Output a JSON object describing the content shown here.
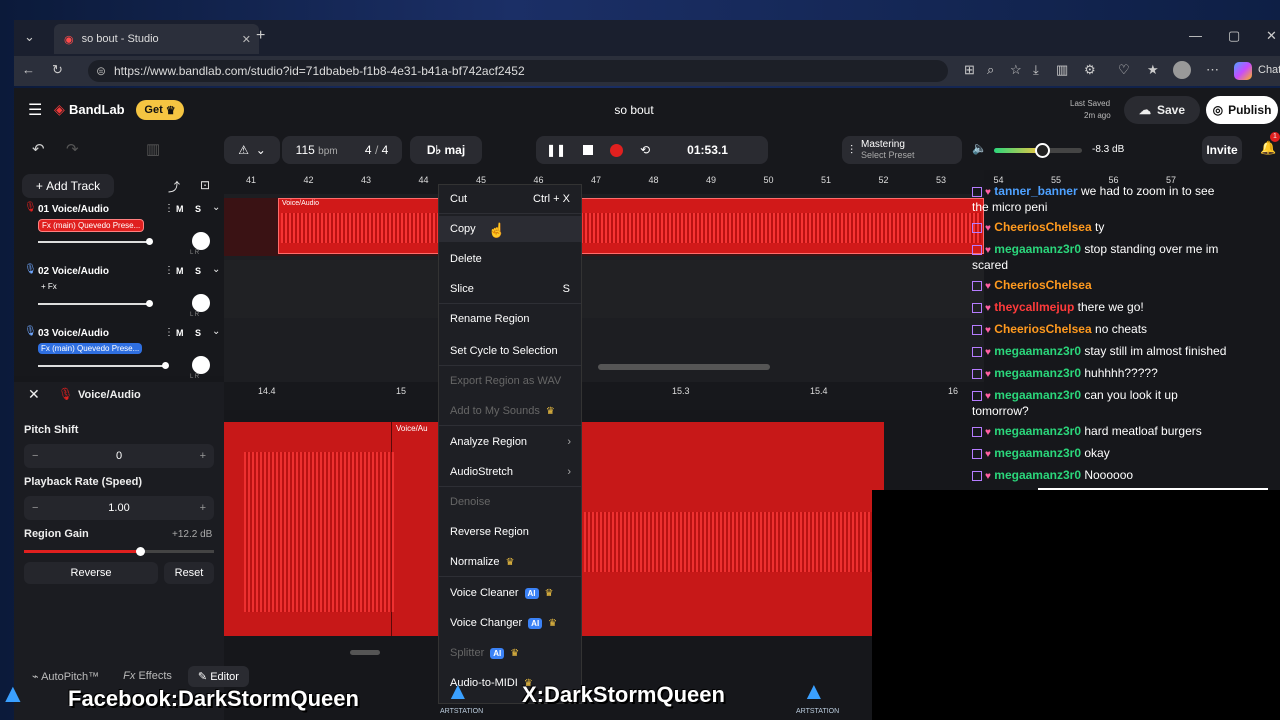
{
  "browser": {
    "tab_title": "so bout - Studio",
    "url": "https://www.bandlab.com/studio?id=71dbabeb-f1b8-4e31-b41a-bf742acf2452",
    "chat_label": "Chat"
  },
  "app": {
    "logo": "BandLab",
    "get_label": "Get",
    "project_title": "so bout",
    "last_saved_label": "Last Saved",
    "last_saved_time": "2m ago",
    "save_label": "Save",
    "publish_label": "Publish",
    "bpm": "115",
    "bpm_unit": "bpm",
    "time_sig_num": "4",
    "time_sig_den": "4",
    "key": "D♭ maj",
    "time": "01:53.1",
    "mastering_label": "Mastering",
    "mastering_sub": "Select Preset",
    "volume_db": "-8.3 dB",
    "invite_label": "Invite",
    "notif_count": "1",
    "volume_level": 0.55
  },
  "tracks": {
    "add_track_label": "Add Track",
    "list": [
      {
        "name": "01  Voice/Audio",
        "fx": "Fx (main) Quevedo Prese...",
        "fx_style": "red",
        "m": "M",
        "s": "S",
        "lr": "L   R"
      },
      {
        "name": "02  Voice/Audio",
        "fx": "+ Fx",
        "fx_style": "plain",
        "m": "M",
        "s": "S",
        "lr": "L   R"
      },
      {
        "name": "03  Voice/Audio",
        "fx": "Fx (main) Quevedo Prese...",
        "fx_style": "blue",
        "m": "M",
        "s": "S",
        "lr": "L   R"
      }
    ],
    "ruler": [
      "41",
      "42",
      "43",
      "44",
      "45",
      "46",
      "47",
      "48",
      "49",
      "50",
      "51",
      "52",
      "53",
      "54",
      "55",
      "56",
      "57"
    ],
    "region_label": "Voice/Audio"
  },
  "editor": {
    "title": "Voice/Audio",
    "ruler": [
      "14.4",
      "15",
      "15.3",
      "15.4",
      "16"
    ],
    "ruler2": "16.2",
    "region_label": "Voice/Au",
    "pitch_label": "Pitch Shift",
    "pitch_value": "0",
    "rate_label": "Playback Rate (Speed)",
    "rate_value": "1.00",
    "gain_label": "Region Gain",
    "gain_value": "+12.2 dB",
    "reverse_label": "Reverse",
    "reset_label": "Reset",
    "autopitch_label": "AutoPitch™",
    "effects_label": "Effects",
    "editor_label": "Editor"
  },
  "menu": {
    "items": [
      {
        "label": "Cut",
        "shortcut": "Ctrl + X",
        "state": "normal"
      },
      {
        "label": "Copy",
        "shortcut": "",
        "state": "hover"
      },
      {
        "label": "Delete",
        "shortcut": "",
        "state": "normal"
      },
      {
        "label": "Slice",
        "shortcut": "S",
        "state": "normal"
      },
      {
        "label": "Rename Region",
        "shortcut": "",
        "state": "normal"
      },
      {
        "label": "Set Cycle to Selection",
        "shortcut": "",
        "state": "normal"
      },
      {
        "label": "Export Region as WAV",
        "shortcut": "",
        "state": "disabled"
      },
      {
        "label": "Add to My Sounds",
        "shortcut": "",
        "state": "disabled",
        "crown": true
      },
      {
        "label": "Analyze Region",
        "shortcut": "",
        "state": "normal",
        "arrow": true
      },
      {
        "label": "AudioStretch",
        "shortcut": "",
        "state": "normal",
        "arrow": true
      },
      {
        "label": "Denoise",
        "shortcut": "",
        "state": "disabled"
      },
      {
        "label": "Reverse Region",
        "shortcut": "",
        "state": "normal"
      },
      {
        "label": "Normalize",
        "shortcut": "",
        "state": "normal",
        "crown": true
      },
      {
        "label": "Voice Cleaner",
        "shortcut": "",
        "state": "normal",
        "ai": "AI",
        "crown": true
      },
      {
        "label": "Voice Changer",
        "shortcut": "",
        "state": "normal",
        "ai": "AI",
        "crown": true
      },
      {
        "label": "Splitter",
        "shortcut": "",
        "state": "disabled",
        "ai": "AI",
        "crown": true
      },
      {
        "label": "Audio-to-MIDI",
        "shortcut": "",
        "state": "normal",
        "crown": true
      }
    ]
  },
  "chat": [
    {
      "user": "tanner_banner",
      "color": "#4ea1ff",
      "msg": "we had to zoom in to see the micro peni"
    },
    {
      "user": "CheeriosChelsea",
      "color": "#ff9a1f",
      "msg": "ty"
    },
    {
      "user": "megaamanz3r0",
      "color": "#2bd67b",
      "msg": "stop standing over me im scared"
    },
    {
      "user": "CheeriosChelsea",
      "color": "#ff9a1f",
      "msg": ""
    },
    {
      "user": "theycallmejup",
      "color": "#ff3b3b",
      "msg": "there we go!"
    },
    {
      "user": "CheeriosChelsea",
      "color": "#ff9a1f",
      "msg": "no cheats"
    },
    {
      "user": "megaamanz3r0",
      "color": "#2bd67b",
      "msg": "stay still im almost finished"
    },
    {
      "user": "megaamanz3r0",
      "color": "#2bd67b",
      "msg": "huhhhh?????"
    },
    {
      "user": "megaamanz3r0",
      "color": "#2bd67b",
      "msg": "can you look it up tomorrow?"
    },
    {
      "user": "megaamanz3r0",
      "color": "#2bd67b",
      "msg": "hard meatloaf burgers"
    },
    {
      "user": "megaamanz3r0",
      "color": "#2bd67b",
      "msg": "okay"
    },
    {
      "user": "megaamanz3r0",
      "color": "#2bd67b",
      "msg": "Noooooo"
    }
  ],
  "overlay": {
    "facebook": "Facebook:DarkStormQueen",
    "x": "X:DarkStormQueen",
    "artstation": "ARTSTATION"
  }
}
